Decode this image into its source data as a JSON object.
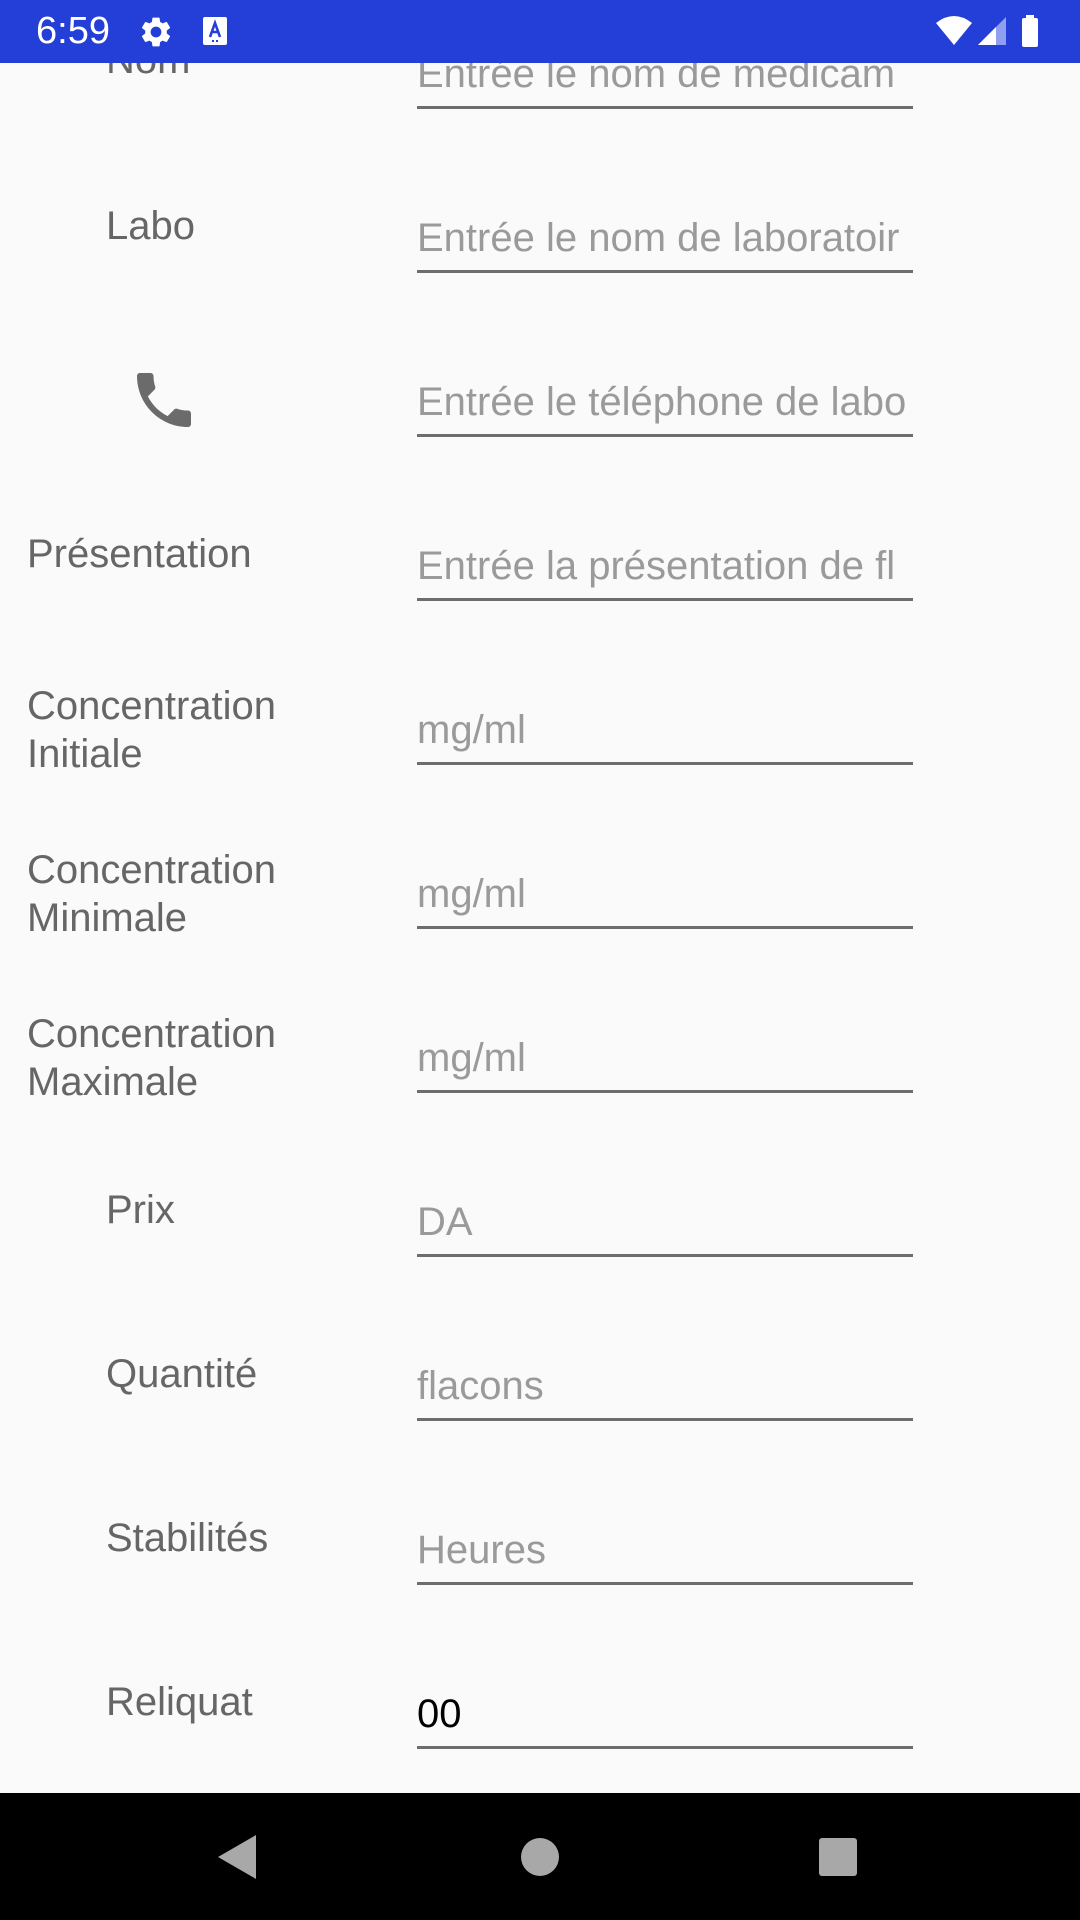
{
  "status_bar": {
    "time": "6:59",
    "icons": [
      "settings-gear-icon",
      "accessibility-a-icon",
      "wifi-icon",
      "cell-signal-icon",
      "battery-icon"
    ],
    "background_color": "#243fd7"
  },
  "form": {
    "fields": [
      {
        "label": "Nom",
        "placeholder": "Entrée le nom de medicam",
        "value": ""
      },
      {
        "label": "Labo",
        "placeholder": "Entrée le nom de laboratoir",
        "value": ""
      },
      {
        "label": "",
        "icon": "phone-icon",
        "placeholder": "Entrée le téléphone de labo",
        "value": ""
      },
      {
        "label": "Présentation",
        "placeholder": "Entrée la présentation de fl",
        "value": ""
      },
      {
        "label_line1": "Concentration",
        "label_line2": "Initiale",
        "placeholder": "mg/ml",
        "value": ""
      },
      {
        "label_line1": "Concentration",
        "label_line2": "Minimale",
        "placeholder": "mg/ml",
        "value": ""
      },
      {
        "label_line1": "Concentration",
        "label_line2": "Maximale",
        "placeholder": "mg/ml",
        "value": ""
      },
      {
        "label": "Prix",
        "placeholder": "DA",
        "value": ""
      },
      {
        "label": "Quantité",
        "placeholder": "flacons",
        "value": ""
      },
      {
        "label": "Stabilités",
        "placeholder": "Heures",
        "value": ""
      },
      {
        "label": "Reliquat",
        "placeholder": "",
        "value": "00"
      }
    ]
  },
  "nav_bar": {
    "buttons": [
      "back-triangle-icon",
      "home-circle-icon",
      "recents-square-icon"
    ]
  }
}
